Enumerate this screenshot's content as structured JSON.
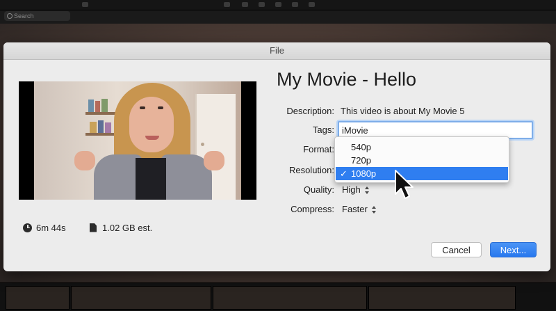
{
  "background": {
    "search_placeholder": "Search"
  },
  "dialog": {
    "title": "File",
    "movie_title": "My Movie - Hello",
    "stats": {
      "duration": "6m 44s",
      "size": "1.02 GB est."
    },
    "fields": {
      "description_label": "Description:",
      "description_value": "This video is about My Movie 5",
      "tags_label": "Tags:",
      "tags_value": "iMovie",
      "format_label": "Format:",
      "resolution_label": "Resolution:",
      "quality_label": "Quality:",
      "quality_value": "High",
      "compress_label": "Compress:",
      "compress_value": "Faster"
    },
    "resolution_menu": {
      "options": [
        "540p",
        "720p",
        "1080p"
      ],
      "selected": "1080p",
      "checkmark": "✓"
    },
    "buttons": {
      "cancel": "Cancel",
      "next": "Next..."
    }
  },
  "colors": {
    "accent": "#2f7ef0",
    "focus_ring": "#7faee9",
    "dialog_bg": "#ececec"
  },
  "icons": {
    "duration": "clock-icon",
    "size": "file-icon",
    "stepper": "up-down-chevron-icon",
    "pointer": "mouse-cursor-icon"
  }
}
